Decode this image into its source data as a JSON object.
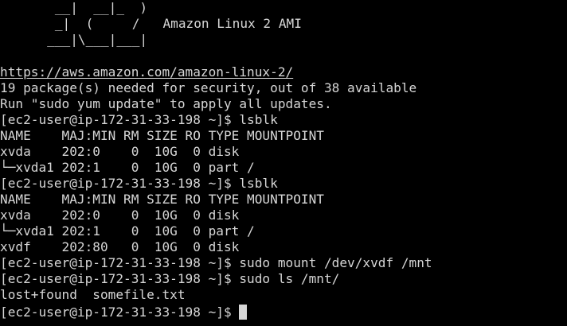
{
  "terminal": {
    "banner": [
      "       __|  __|_  )",
      "       _|  (     /   Amazon Linux 2 AMI",
      "      ___|\\___|___|"
    ],
    "url": "https://aws.amazon.com/amazon-linux-2/",
    "lines": [
      "19 package(s) needed for security, out of 38 available",
      "Run \"sudo yum update\" to apply all updates.",
      "[ec2-user@ip-172-31-33-198 ~]$ lsblk",
      "NAME    MAJ:MIN RM SIZE RO TYPE MOUNTPOINT",
      "xvda    202:0    0  10G  0 disk",
      "└─xvda1 202:1    0  10G  0 part /",
      "[ec2-user@ip-172-31-33-198 ~]$ lsblk",
      "NAME    MAJ:MIN RM SIZE RO TYPE MOUNTPOINT",
      "xvda    202:0    0  10G  0 disk",
      "└─xvda1 202:1    0  10G  0 part /",
      "xvdf    202:80   0  10G  0 disk",
      "[ec2-user@ip-172-31-33-198 ~]$ sudo mount /dev/xvdf /mnt",
      "[ec2-user@ip-172-31-33-198 ~]$ sudo ls /mnt/",
      "lost+found  somefile.txt"
    ],
    "prompt": "[ec2-user@ip-172-31-33-198 ~]$ ",
    "colors": {
      "background": "#000000",
      "foreground": "#d6d6d6"
    }
  }
}
